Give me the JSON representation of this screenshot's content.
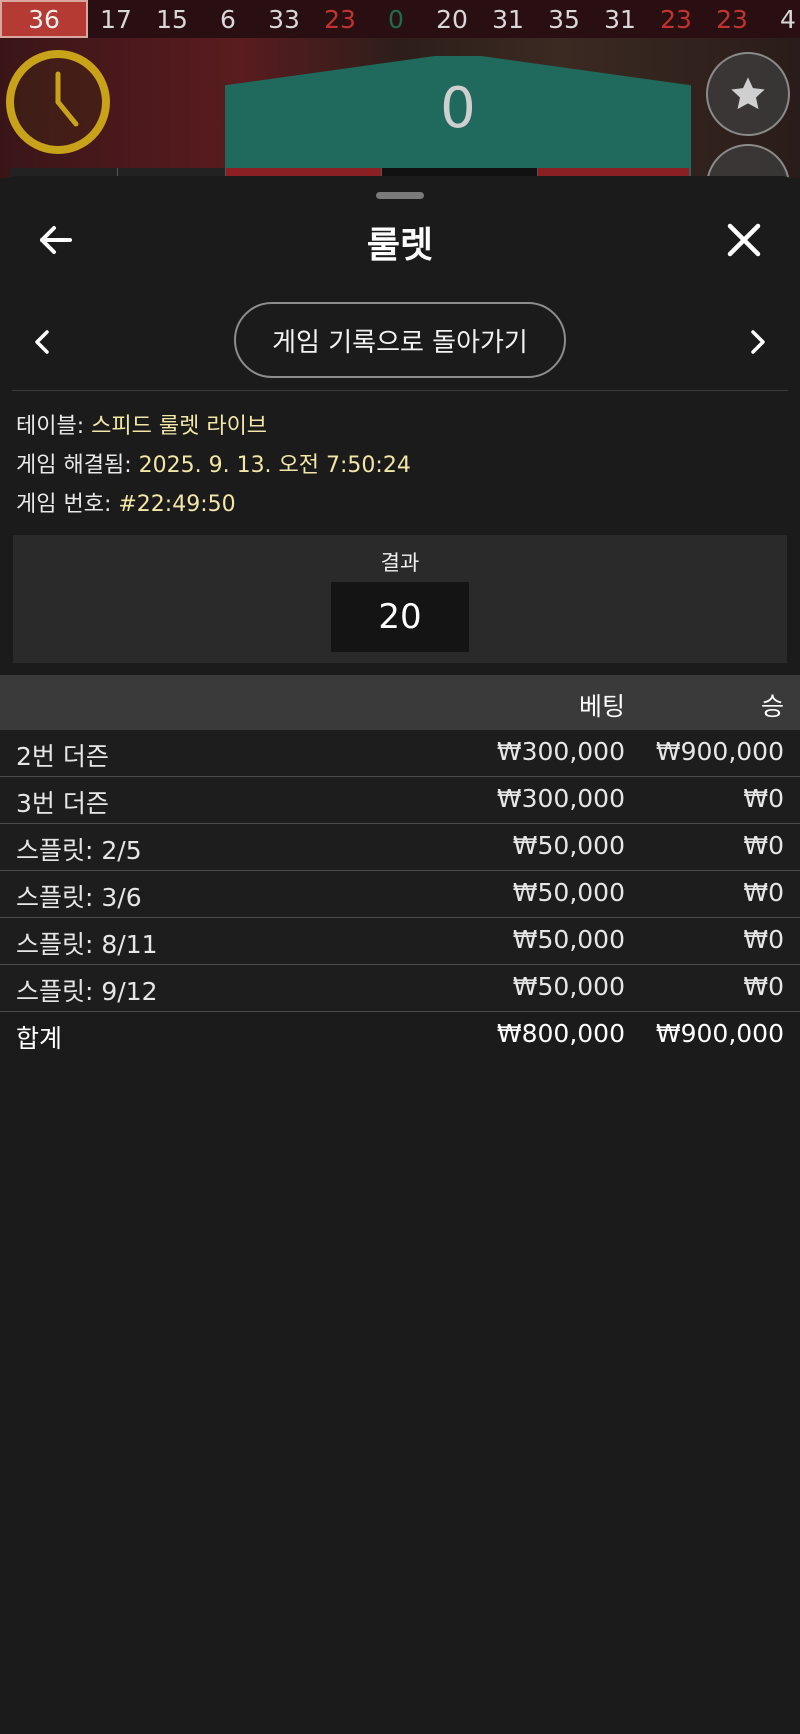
{
  "history": [
    "36",
    "17",
    "15",
    "6",
    "33",
    "23",
    "0",
    "20",
    "31",
    "35",
    "31",
    "23",
    "23",
    "4"
  ],
  "colors": {
    "accent_gold": "#f2e7a6",
    "timer_ring": "#c8a31a",
    "wheel_green": "#1f6a5c",
    "red_number": "#c2332e"
  },
  "backdrop": {
    "wheel_number": "0",
    "favorite_icon": "star-icon"
  },
  "header": {
    "title": "룰렛",
    "back_icon": "arrow-left-icon",
    "close_icon": "close-icon"
  },
  "nav": {
    "prev_icon": "chevron-left-icon",
    "next_icon": "chevron-right-icon",
    "return_label": "게임 기록으로 돌아가기"
  },
  "info": {
    "table_label": "테이블:",
    "table_value": "스피드 룰렛 라이브",
    "resolved_label": "게임 해결됨:",
    "resolved_value": "2025. 9. 13. 오전 7:50:24",
    "game_no_label": "게임 번호:",
    "game_no_value": "#22:49:50"
  },
  "result": {
    "label": "결과",
    "value": "20"
  },
  "table": {
    "col_bet": "베팅",
    "col_win": "승",
    "rows": [
      {
        "name": "2번 더즌",
        "bet": "₩300,000",
        "win": "₩900,000"
      },
      {
        "name": "3번 더즌",
        "bet": "₩300,000",
        "win": "₩0"
      },
      {
        "name": "스플릿: 2/5",
        "bet": "₩50,000",
        "win": "₩0"
      },
      {
        "name": "스플릿: 3/6",
        "bet": "₩50,000",
        "win": "₩0"
      },
      {
        "name": "스플릿: 8/11",
        "bet": "₩50,000",
        "win": "₩0"
      },
      {
        "name": "스플릿: 9/12",
        "bet": "₩50,000",
        "win": "₩0"
      }
    ],
    "total": {
      "name": "합계",
      "bet": "₩800,000",
      "win": "₩900,000"
    }
  }
}
